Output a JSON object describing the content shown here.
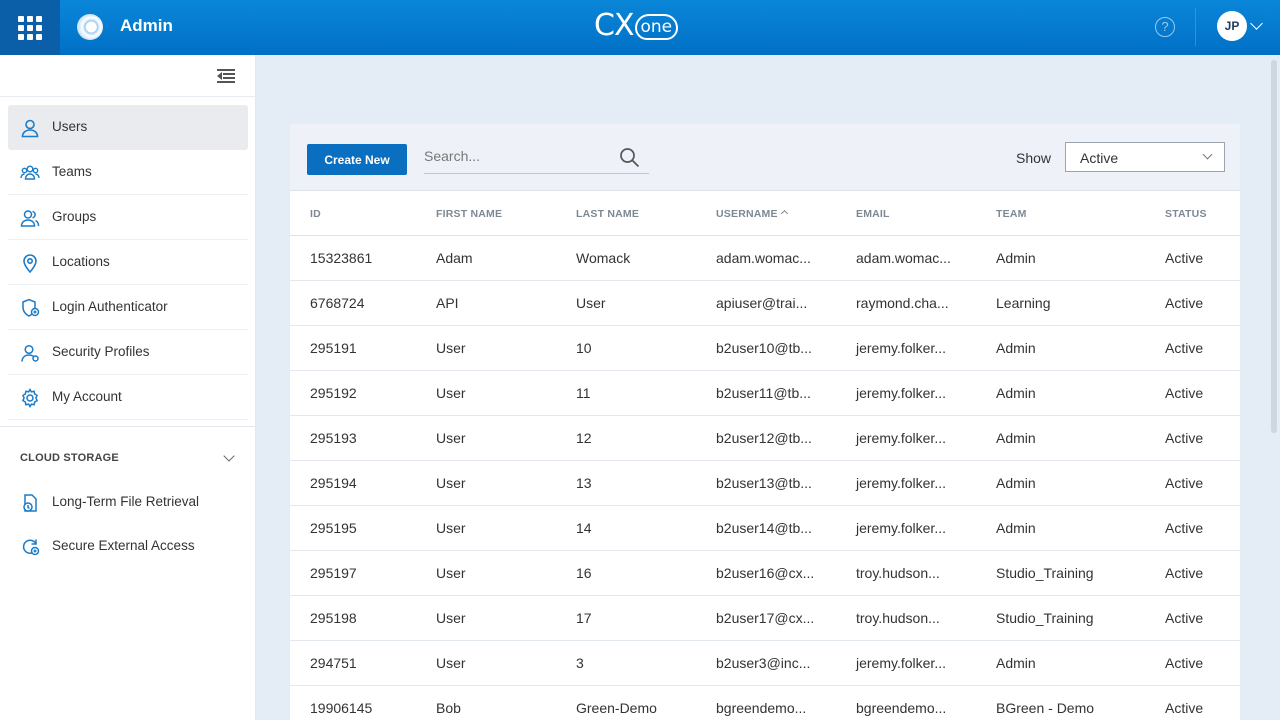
{
  "header": {
    "app_title": "Admin",
    "brand_prefix": "CX",
    "brand_suffix": "one",
    "help": "?",
    "user_initials": "JP"
  },
  "sidebar": {
    "items": [
      {
        "label": "Users",
        "icon": "user-icon",
        "active": true
      },
      {
        "label": "Teams",
        "icon": "team-icon",
        "active": false
      },
      {
        "label": "Groups",
        "icon": "group-icon",
        "active": false
      },
      {
        "label": "Locations",
        "icon": "location-pin-icon",
        "active": false
      },
      {
        "label": "Login Authenticator",
        "icon": "shield-user-icon",
        "active": false
      },
      {
        "label": "Security Profiles",
        "icon": "security-profile-icon",
        "active": false
      },
      {
        "label": "My Account",
        "icon": "gear-icon",
        "active": false
      }
    ],
    "section_title": "CLOUD STORAGE",
    "section_items": [
      {
        "label": "Long-Term File Retrieval",
        "icon": "file-retrieval-icon"
      },
      {
        "label": "Secure External Access",
        "icon": "secure-access-icon"
      }
    ]
  },
  "toolbar": {
    "create_label": "Create New",
    "search_placeholder": "Search...",
    "show_label": "Show",
    "show_value": "Active"
  },
  "table": {
    "columns": [
      "ID",
      "FIRST NAME",
      "LAST NAME",
      "USERNAME",
      "EMAIL",
      "TEAM",
      "STATUS"
    ],
    "sorted_column": "USERNAME",
    "rows": [
      [
        "15323861",
        "Adam",
        "Womack",
        "adam.womac...",
        "adam.womac...",
        "Admin",
        "Active"
      ],
      [
        "6768724",
        "API",
        "User",
        "apiuser@trai...",
        "raymond.cha...",
        "Learning",
        "Active"
      ],
      [
        "295191",
        "User",
        "10",
        "b2user10@tb...",
        "jeremy.folker...",
        "Admin",
        "Active"
      ],
      [
        "295192",
        "User",
        "11",
        "b2user11@tb...",
        "jeremy.folker...",
        "Admin",
        "Active"
      ],
      [
        "295193",
        "User",
        "12",
        "b2user12@tb...",
        "jeremy.folker...",
        "Admin",
        "Active"
      ],
      [
        "295194",
        "User",
        "13",
        "b2user13@tb...",
        "jeremy.folker...",
        "Admin",
        "Active"
      ],
      [
        "295195",
        "User",
        "14",
        "b2user14@tb...",
        "jeremy.folker...",
        "Admin",
        "Active"
      ],
      [
        "295197",
        "User",
        "16",
        "b2user16@cx...",
        "troy.hudson...",
        "Studio_Training",
        "Active"
      ],
      [
        "295198",
        "User",
        "17",
        "b2user17@cx...",
        "troy.hudson...",
        "Studio_Training",
        "Active"
      ],
      [
        "294751",
        "User",
        "3",
        "b2user3@inc...",
        "jeremy.folker...",
        "Admin",
        "Active"
      ],
      [
        "19906145",
        "Bob",
        "Green-Demo",
        "bgreendemo...",
        "bgreendemo...",
        "BGreen - Demo",
        "Active"
      ]
    ]
  },
  "colors": {
    "header_blue": "#0a7ed2",
    "launcher_blue": "#0a5fa8",
    "primary_button": "#0a6fc0",
    "sidebar_icon": "#1a7cc8",
    "page_background": "#e4ecf6"
  }
}
